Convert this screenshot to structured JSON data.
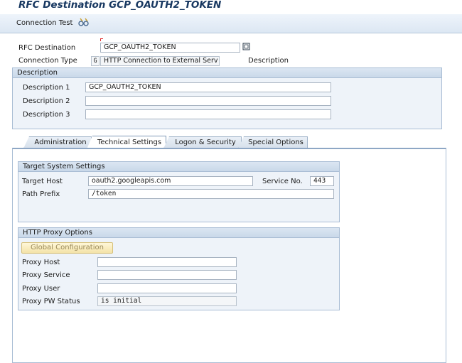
{
  "window": {
    "title": "RFC Destination GCP_OAUTH2_TOKEN"
  },
  "toolbar": {
    "connection_test_label": "Connection Test",
    "icon": "glasses-icon"
  },
  "header": {
    "rfc_destination_label": "RFC Destination",
    "rfc_destination_value": "GCP_OAUTH2_TOKEN",
    "connection_type_label": "Connection Type",
    "connection_type_code": "G",
    "connection_type_value": "HTTP Connection to External Serv",
    "description_link": "Description"
  },
  "description": {
    "title": "Description",
    "d1_label": "Description 1",
    "d1_value": "GCP_OAUTH2_TOKEN",
    "d2_label": "Description 2",
    "d2_value": "",
    "d3_label": "Description 3",
    "d3_value": ""
  },
  "tabs": [
    {
      "label": "Administration",
      "active": false
    },
    {
      "label": "Technical Settings",
      "active": true
    },
    {
      "label": "Logon & Security",
      "active": false
    },
    {
      "label": "Special Options",
      "active": false
    }
  ],
  "target": {
    "title": "Target System Settings",
    "host_label": "Target Host",
    "host_value": "oauth2.googleapis.com",
    "service_label": "Service No.",
    "service_value": "443",
    "path_label": "Path Prefix",
    "path_value": "/token"
  },
  "proxy": {
    "title": "HTTP Proxy Options",
    "global_config_button": "Global Configuration",
    "host_label": "Proxy Host",
    "host_value": "",
    "service_label": "Proxy Service",
    "service_value": "",
    "user_label": "Proxy User",
    "user_value": "",
    "pw_label": "Proxy PW Status",
    "pw_value": "is initial"
  },
  "colors": {
    "title": "#183861",
    "panel": "#eef3f9",
    "accent_border": "#a9bdd4"
  }
}
